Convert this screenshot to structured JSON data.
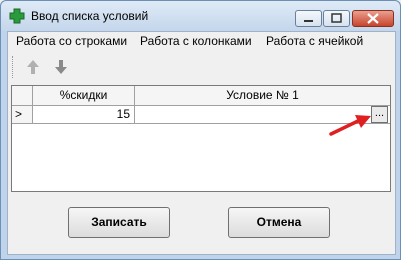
{
  "window": {
    "title": "Ввод списка условий",
    "accent_color": "#2a9b3c"
  },
  "menu": [
    "Работа со строками",
    "Работа с колонками",
    "Работа с ячейкой"
  ],
  "toolbar": {
    "buttons": [
      {
        "icon": "move-up-icon",
        "enabled": false
      },
      {
        "icon": "move-down-icon",
        "enabled": false
      }
    ]
  },
  "grid": {
    "columns": [
      "%скидки",
      "Условие № 1"
    ],
    "rows": [
      {
        "indicator": ">",
        "discount": "15",
        "condition": ""
      }
    ],
    "ellipsis_label": "..."
  },
  "annotation": {
    "arrow_color": "#e02020"
  },
  "buttons": {
    "save_label": "Записать",
    "cancel_label": "Отмена"
  }
}
